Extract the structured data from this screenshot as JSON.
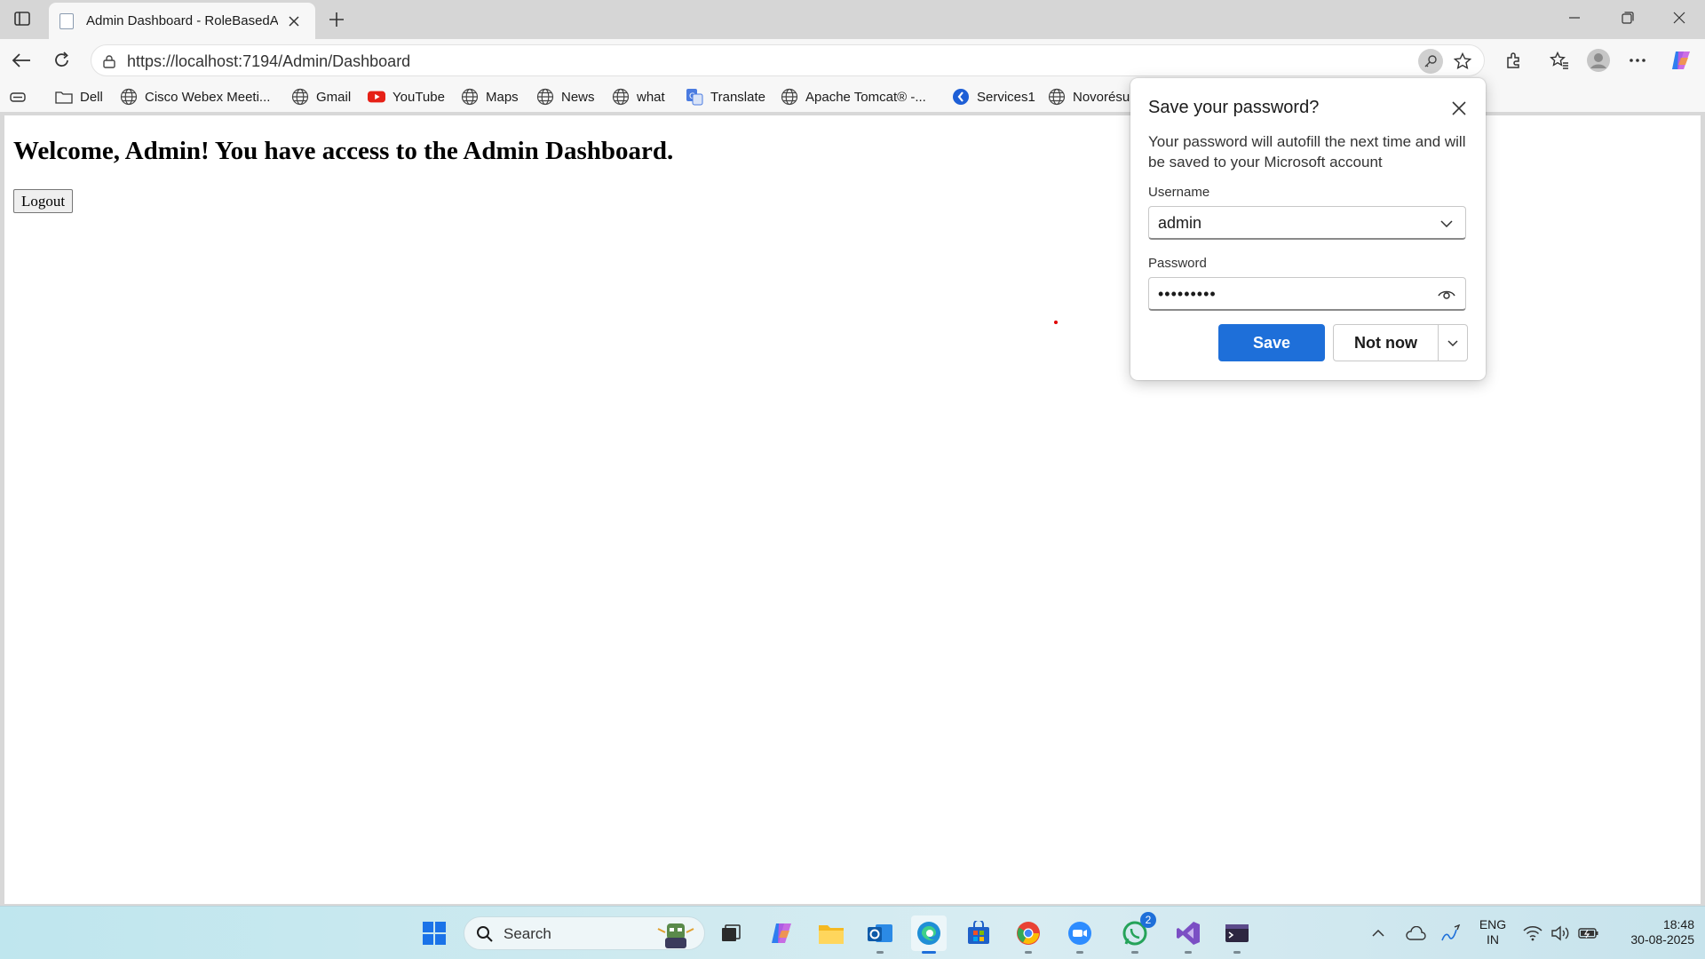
{
  "browser": {
    "tab": {
      "title": "Admin Dashboard - RoleBasedAu"
    },
    "address": {
      "url": "https://localhost:7194/Admin/Dashboard"
    }
  },
  "bookmarks": [
    {
      "label": "Dell",
      "icon": "folder-icon"
    },
    {
      "label": "Cisco Webex Meeti...",
      "icon": "globe-icon"
    },
    {
      "label": "Gmail",
      "icon": "globe-icon"
    },
    {
      "label": "YouTube",
      "icon": "youtube-icon"
    },
    {
      "label": "Maps",
      "icon": "globe-icon"
    },
    {
      "label": "News",
      "icon": "globe-icon"
    },
    {
      "label": "what",
      "icon": "globe-icon"
    },
    {
      "label": "Translate",
      "icon": "translate-icon"
    },
    {
      "label": "Apache Tomcat® -...",
      "icon": "globe-icon"
    },
    {
      "label": "Services1",
      "icon": "services-icon"
    },
    {
      "label": "Novorésu",
      "icon": "globe-icon"
    }
  ],
  "page": {
    "heading": "Welcome, Admin! You have access to the Admin Dashboard.",
    "logout_label": "Logout"
  },
  "password_popup": {
    "title": "Save your password?",
    "description": "Your password will autofill the next time and will be saved to your Microsoft account",
    "username_label": "Username",
    "username_value": "admin",
    "password_label": "Password",
    "password_value": "•••••••••",
    "save_label": "Save",
    "not_now_label": "Not now"
  },
  "taskbar": {
    "search_label": "Search",
    "whatsapp_badge": "2",
    "language_line1": "ENG",
    "language_line2": "IN",
    "time": "18:48",
    "date": "30-08-2025"
  },
  "colors": {
    "accent": "#1e6fd9",
    "youtube_red": "#e62117"
  }
}
